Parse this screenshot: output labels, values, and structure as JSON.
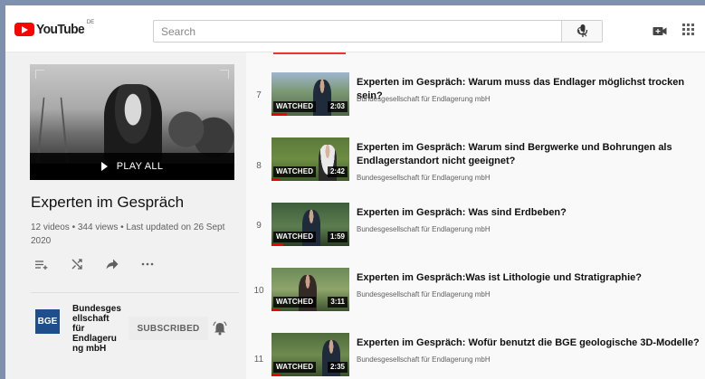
{
  "header": {
    "logo_text": "YouTube",
    "country_code": "DE",
    "search_placeholder": "Search",
    "icons": [
      "search-icon",
      "mic-icon",
      "create-video-icon",
      "apps-icon"
    ]
  },
  "playlist": {
    "play_all_label": "PLAY ALL",
    "title": "Experten im Gespräch",
    "meta": "12 videos • 344 views • Last updated on 26 Sept 2020",
    "actions": [
      "add-to-queue-icon",
      "shuffle-icon",
      "share-icon",
      "more-icon"
    ],
    "channel": {
      "logo_text": "BGE",
      "name": "Bundesgesellschaft für Endlagerung mbH",
      "name_lines": [
        "Bundesges",
        "ellschaft",
        "für",
        "Endlageru",
        "ng mbH"
      ],
      "subscribe_label": "SUBSCRIBED"
    }
  },
  "videos": [
    {
      "index": "7",
      "title": "Experten im Gespräch: Warum muss das Endlager möglichst trocken sein?",
      "channel": "Bundesgesellschaft für Endlagerung mbH",
      "watched_label": "WATCHED",
      "duration": "2:03",
      "progress": 0.2
    },
    {
      "index": "8",
      "title": "Experten im Gespräch: Warum sind Bergwerke und Bohrungen als Endlagerstandort nicht geeignet?",
      "channel": "Bundesgesellschaft für Endlagerung mbH",
      "watched_label": "WATCHED",
      "duration": "2:42",
      "progress": 0.1
    },
    {
      "index": "9",
      "title": "Experten im Gespräch: Was sind Erdbeben?",
      "channel": "Bundesgesellschaft für Endlagerung mbH",
      "watched_label": "WATCHED",
      "duration": "1:59",
      "progress": 0.15
    },
    {
      "index": "10",
      "title": "Experten im Gespräch:Was ist Lithologie und Stratigraphie?",
      "channel": "Bundesgesellschaft für Endlagerung mbH",
      "watched_label": "WATCHED",
      "duration": "3:11",
      "progress": 0.1
    },
    {
      "index": "11",
      "title": "Experten im Gespräch: Wofür benutzt die BGE geologische 3D-Modelle?",
      "channel": "Bundesgesellschaft für Endlagerung mbH",
      "watched_label": "WATCHED",
      "duration": "2:35",
      "progress": 0.12
    }
  ],
  "colors": {
    "brand_red": "#ff0000",
    "progress_red": "#e00000",
    "channel_blue": "#1f4e8c"
  }
}
